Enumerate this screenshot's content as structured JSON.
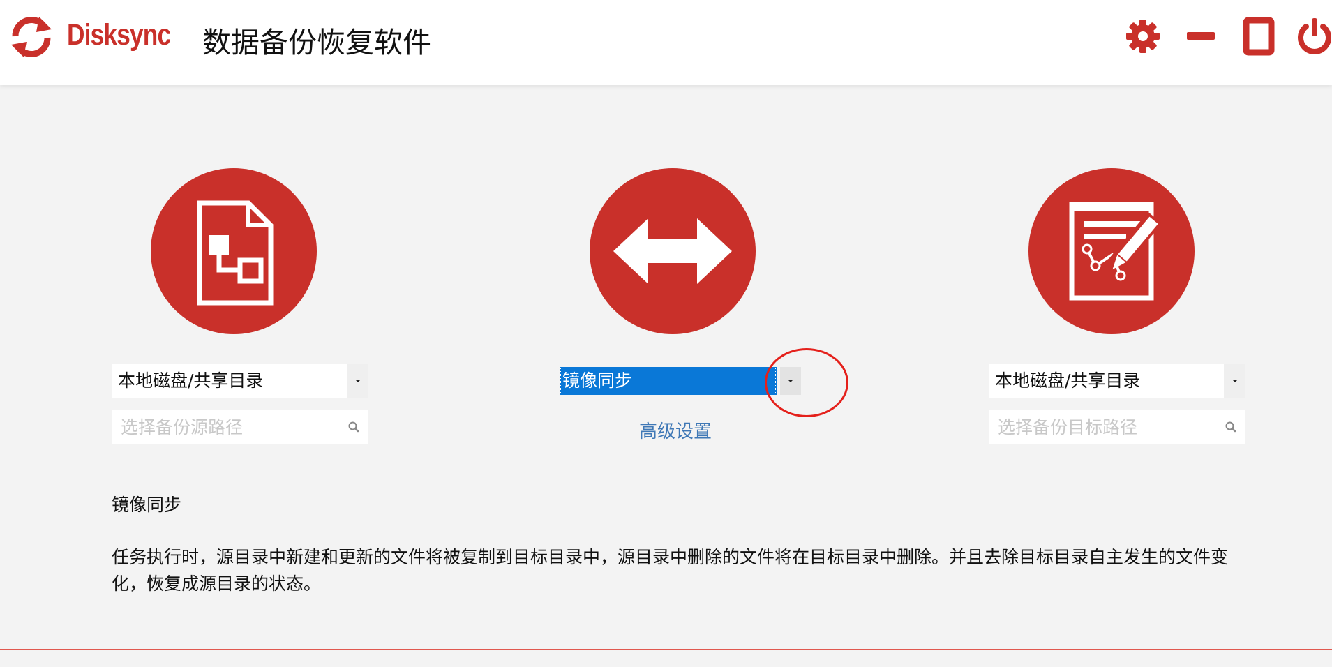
{
  "app": {
    "brand": "Disksync",
    "title": "数据备份恢复软件",
    "accent_color": "#c9302a"
  },
  "window_controls": {
    "icons": [
      "gear-icon",
      "minimize-icon",
      "maximize-icon",
      "power-icon"
    ]
  },
  "source": {
    "icon": "document-structure-icon",
    "type_select": "本地磁盘/共享目录",
    "path_placeholder": "选择备份源路径"
  },
  "mode": {
    "icon": "double-arrow-icon",
    "selected": "镜像同步",
    "advanced_link": "高级设置"
  },
  "target": {
    "icon": "edit-document-icon",
    "type_select": "本地磁盘/共享目录",
    "path_placeholder": "选择备份目标路径"
  },
  "description": {
    "title": "镜像同步",
    "body": "任务执行时，源目录中新建和更新的文件将被复制到目标目录中，源目录中删除的文件将在目标目录中删除。并且去除目标目录自主发生的文件变化，恢复成源目录的状态。"
  }
}
